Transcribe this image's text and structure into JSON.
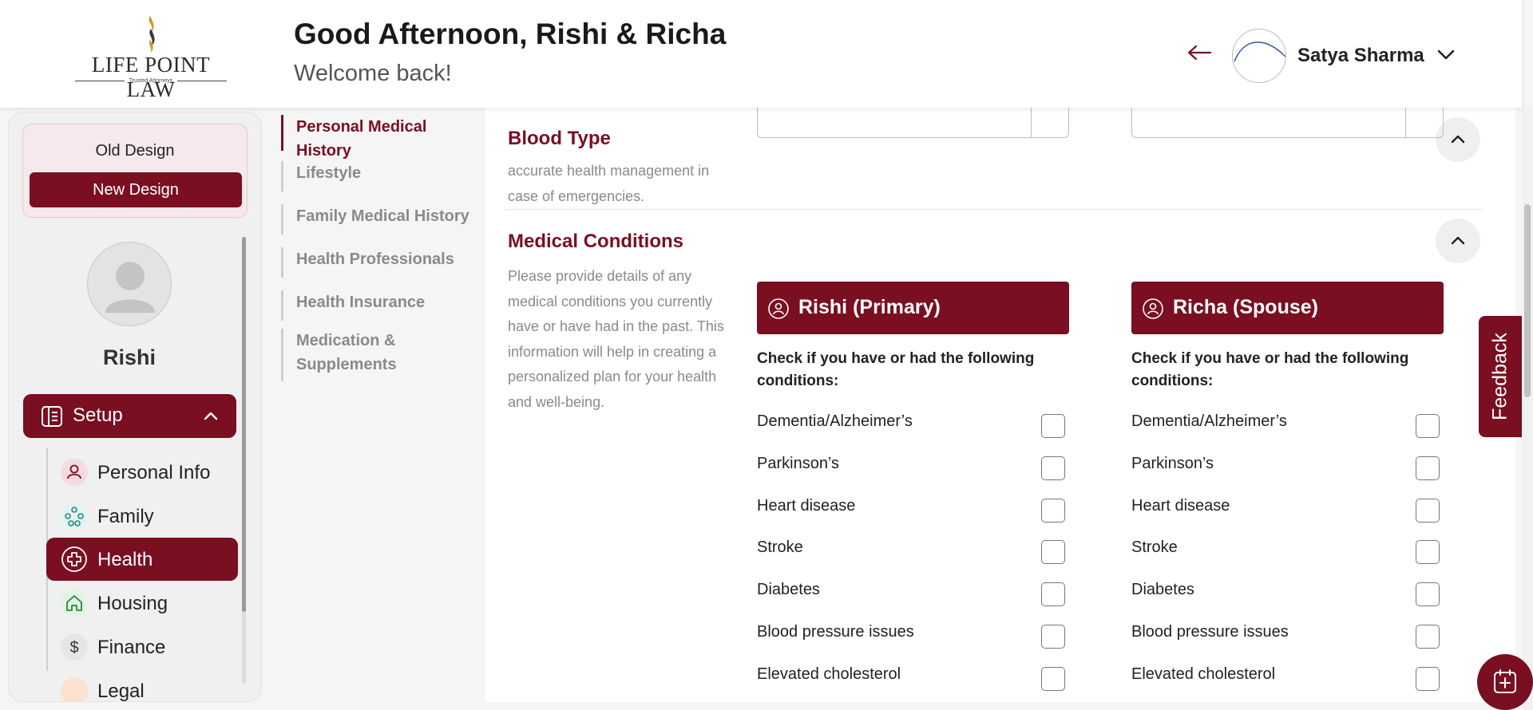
{
  "header": {
    "logo_text": "LIFE POINT LAW",
    "logo_sub": "Trusted Attorneys",
    "greeting": "Good Afternoon, Rishi & Richa",
    "welcome": "Welcome back!",
    "user_name": "Satya Sharma"
  },
  "sidebar": {
    "old_design": "Old Design",
    "new_design": "New Design",
    "profile_name": "Rishi",
    "setup_label": "Setup",
    "items": [
      {
        "label": "Personal Info",
        "icon": "person-icon",
        "active": false
      },
      {
        "label": "Family",
        "icon": "family-tree-icon",
        "active": false
      },
      {
        "label": "Health",
        "icon": "medical-cross-icon",
        "active": true
      },
      {
        "label": "Housing",
        "icon": "home-icon",
        "active": false
      },
      {
        "label": "Finance",
        "icon": "dollar-icon",
        "active": false
      },
      {
        "label": "Legal",
        "icon": "legal-icon",
        "active": false
      }
    ]
  },
  "subnav": {
    "items": [
      {
        "label": "Personal Medical History",
        "active": true
      },
      {
        "label": "Lifestyle",
        "active": false
      },
      {
        "label": "Family Medical History",
        "active": false
      },
      {
        "label": "Health Professionals",
        "active": false
      },
      {
        "label": "Health Insurance",
        "active": false
      },
      {
        "label": "Medication & Supplements",
        "active": false
      }
    ]
  },
  "blood_type": {
    "title": "Blood Type",
    "desc_line1": "accurate health management in",
    "desc_line2": "case of emergencies."
  },
  "medical_conditions": {
    "title": "Medical Conditions",
    "description": "Please provide details of any medical conditions you currently have or have had in the past. This information will help in creating a personalized plan for your health and well-being.",
    "primary_label": "Rishi (Primary)",
    "spouse_label": "Richa (Spouse)",
    "check_title": "Check if you have or had the following conditions:",
    "conditions": [
      "Dementia/Alzheimer’s",
      "Parkinson’s",
      "Heart disease",
      "Stroke",
      "Diabetes",
      "Blood pressure issues",
      "Elevated cholesterol"
    ]
  },
  "feedback_label": "Feedback",
  "colors": {
    "brand": "#7a0f22"
  }
}
